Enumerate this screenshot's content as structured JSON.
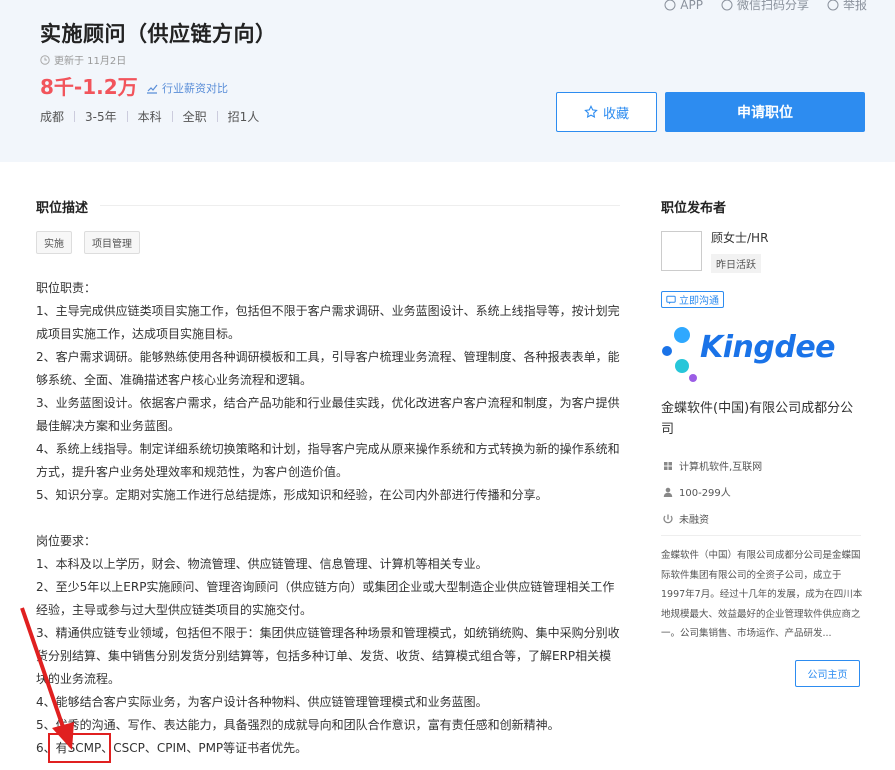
{
  "header": {
    "links": {
      "app": "APP",
      "wechat_share": "微信扫码分享",
      "report": "举报"
    },
    "job_title": "实施顾问（供应链方向）",
    "updated": "更新于 11月2日",
    "salary": "8千-1.2万",
    "salary_compare": "行业薪资对比",
    "tags": [
      "成都",
      "3-5年",
      "本科",
      "全职",
      "招1人"
    ],
    "favorite_label": "收藏",
    "apply_label": "申请职位"
  },
  "description": {
    "title": "职位描述",
    "skill_tags": [
      "实施",
      "项目管理"
    ],
    "lines": [
      "职位职责：",
      "1、主导完成供应链类项目实施工作，包括但不限于客户需求调研、业务蓝图设计、系统上线指导等，按计划完成项目实施工作，达成项目实施目标。",
      "2、客户需求调研。能够熟练使用各种调研模板和工具，引导客户梳理业务流程、管理制度、各种报表表单，能够系统、全面、准确描述客户核心业务流程和逻辑。",
      "3、业务蓝图设计。依据客户需求，结合产品功能和行业最佳实践，优化改进客户客户流程和制度，为客户提供最佳解决方案和业务蓝图。",
      "4、系统上线指导。制定详细系统切换策略和计划，指导客户完成从原来操作系统和方式转换为新的操作系统和方式，提升客户业务处理效率和规范性，为客户创造价值。",
      "5、知识分享。定期对实施工作进行总结提炼，形成知识和经验，在公司内外部进行传播和分享。",
      "",
      "岗位要求：",
      "1、本科及以上学历，财会、物流管理、供应链管理、信息管理、计算机等相关专业。",
      "2、至少5年以上ERP实施顾问、管理咨询顾问（供应链方向）或集团企业或大型制造企业供应链管理相关工作经验，主导或参与过大型供应链类项目的实施交付。",
      "3、精通供应链专业领域，包括但不限于：集团供应链管理各种场景和管理模式，如统销统购、集中采购分别收货分别结算、集中销售分别发货分别结算等，包括多种订单、发货、收货、结算模式组合等，了解ERP相关模块的业务流程。",
      "4、能够结合客户实际业务，为客户设计各种物料、供应链管理管理模式和业务蓝图。",
      "5、优秀的沟通、写作、表达能力，具备强烈的成就导向和团队合作意识，富有责任感和创新精神。",
      "6、有SCMP、CSCP、CPIM、PMP等证书者优先。"
    ]
  },
  "publisher": {
    "title": "职位发布者",
    "name": "顾女士/HR",
    "active": "昨日活跃",
    "chat_label": "立即沟通"
  },
  "company": {
    "logo_text": "Kingdee",
    "name": "金蝶软件(中国)有限公司成都分公司",
    "industry": "计算机软件,互联网",
    "size": "100-299人",
    "funding": "未融资",
    "intro": "金蝶软件（中国）有限公司成都分公司是金蝶国际软件集团有限公司的全资子公司，成立于1997年7月。经过十几年的发展，成为在四川本地规模最大、效益最好的企业管理软件供应商之一。公司集销售、市场运作、产品研发...",
    "home_label": "公司主页"
  },
  "colors": {
    "accent": "#2d8cf0",
    "salary": "#f2545b",
    "highlight_box": "#e02020"
  }
}
